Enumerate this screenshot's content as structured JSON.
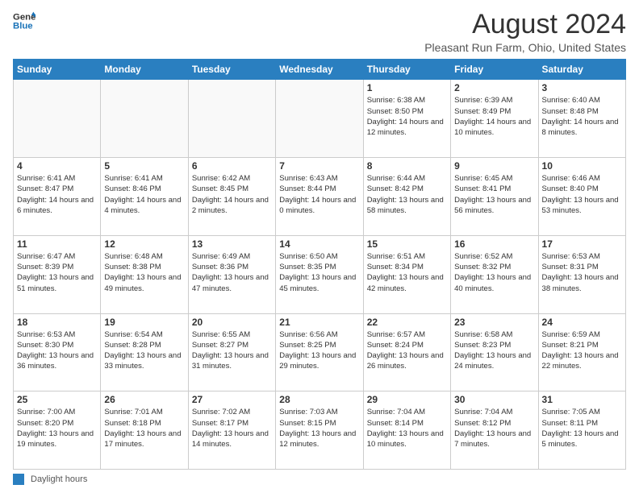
{
  "header": {
    "logo_line1": "General",
    "logo_line2": "Blue",
    "title": "August 2024",
    "subtitle": "Pleasant Run Farm, Ohio, United States"
  },
  "calendar": {
    "days_of_week": [
      "Sunday",
      "Monday",
      "Tuesday",
      "Wednesday",
      "Thursday",
      "Friday",
      "Saturday"
    ],
    "weeks": [
      [
        {
          "day": "",
          "info": ""
        },
        {
          "day": "",
          "info": ""
        },
        {
          "day": "",
          "info": ""
        },
        {
          "day": "",
          "info": ""
        },
        {
          "day": "1",
          "info": "Sunrise: 6:38 AM\nSunset: 8:50 PM\nDaylight: 14 hours and 12 minutes."
        },
        {
          "day": "2",
          "info": "Sunrise: 6:39 AM\nSunset: 8:49 PM\nDaylight: 14 hours and 10 minutes."
        },
        {
          "day": "3",
          "info": "Sunrise: 6:40 AM\nSunset: 8:48 PM\nDaylight: 14 hours and 8 minutes."
        }
      ],
      [
        {
          "day": "4",
          "info": "Sunrise: 6:41 AM\nSunset: 8:47 PM\nDaylight: 14 hours and 6 minutes."
        },
        {
          "day": "5",
          "info": "Sunrise: 6:41 AM\nSunset: 8:46 PM\nDaylight: 14 hours and 4 minutes."
        },
        {
          "day": "6",
          "info": "Sunrise: 6:42 AM\nSunset: 8:45 PM\nDaylight: 14 hours and 2 minutes."
        },
        {
          "day": "7",
          "info": "Sunrise: 6:43 AM\nSunset: 8:44 PM\nDaylight: 14 hours and 0 minutes."
        },
        {
          "day": "8",
          "info": "Sunrise: 6:44 AM\nSunset: 8:42 PM\nDaylight: 13 hours and 58 minutes."
        },
        {
          "day": "9",
          "info": "Sunrise: 6:45 AM\nSunset: 8:41 PM\nDaylight: 13 hours and 56 minutes."
        },
        {
          "day": "10",
          "info": "Sunrise: 6:46 AM\nSunset: 8:40 PM\nDaylight: 13 hours and 53 minutes."
        }
      ],
      [
        {
          "day": "11",
          "info": "Sunrise: 6:47 AM\nSunset: 8:39 PM\nDaylight: 13 hours and 51 minutes."
        },
        {
          "day": "12",
          "info": "Sunrise: 6:48 AM\nSunset: 8:38 PM\nDaylight: 13 hours and 49 minutes."
        },
        {
          "day": "13",
          "info": "Sunrise: 6:49 AM\nSunset: 8:36 PM\nDaylight: 13 hours and 47 minutes."
        },
        {
          "day": "14",
          "info": "Sunrise: 6:50 AM\nSunset: 8:35 PM\nDaylight: 13 hours and 45 minutes."
        },
        {
          "day": "15",
          "info": "Sunrise: 6:51 AM\nSunset: 8:34 PM\nDaylight: 13 hours and 42 minutes."
        },
        {
          "day": "16",
          "info": "Sunrise: 6:52 AM\nSunset: 8:32 PM\nDaylight: 13 hours and 40 minutes."
        },
        {
          "day": "17",
          "info": "Sunrise: 6:53 AM\nSunset: 8:31 PM\nDaylight: 13 hours and 38 minutes."
        }
      ],
      [
        {
          "day": "18",
          "info": "Sunrise: 6:53 AM\nSunset: 8:30 PM\nDaylight: 13 hours and 36 minutes."
        },
        {
          "day": "19",
          "info": "Sunrise: 6:54 AM\nSunset: 8:28 PM\nDaylight: 13 hours and 33 minutes."
        },
        {
          "day": "20",
          "info": "Sunrise: 6:55 AM\nSunset: 8:27 PM\nDaylight: 13 hours and 31 minutes."
        },
        {
          "day": "21",
          "info": "Sunrise: 6:56 AM\nSunset: 8:25 PM\nDaylight: 13 hours and 29 minutes."
        },
        {
          "day": "22",
          "info": "Sunrise: 6:57 AM\nSunset: 8:24 PM\nDaylight: 13 hours and 26 minutes."
        },
        {
          "day": "23",
          "info": "Sunrise: 6:58 AM\nSunset: 8:23 PM\nDaylight: 13 hours and 24 minutes."
        },
        {
          "day": "24",
          "info": "Sunrise: 6:59 AM\nSunset: 8:21 PM\nDaylight: 13 hours and 22 minutes."
        }
      ],
      [
        {
          "day": "25",
          "info": "Sunrise: 7:00 AM\nSunset: 8:20 PM\nDaylight: 13 hours and 19 minutes."
        },
        {
          "day": "26",
          "info": "Sunrise: 7:01 AM\nSunset: 8:18 PM\nDaylight: 13 hours and 17 minutes."
        },
        {
          "day": "27",
          "info": "Sunrise: 7:02 AM\nSunset: 8:17 PM\nDaylight: 13 hours and 14 minutes."
        },
        {
          "day": "28",
          "info": "Sunrise: 7:03 AM\nSunset: 8:15 PM\nDaylight: 13 hours and 12 minutes."
        },
        {
          "day": "29",
          "info": "Sunrise: 7:04 AM\nSunset: 8:14 PM\nDaylight: 13 hours and 10 minutes."
        },
        {
          "day": "30",
          "info": "Sunrise: 7:04 AM\nSunset: 8:12 PM\nDaylight: 13 hours and 7 minutes."
        },
        {
          "day": "31",
          "info": "Sunrise: 7:05 AM\nSunset: 8:11 PM\nDaylight: 13 hours and 5 minutes."
        }
      ]
    ]
  },
  "legend": {
    "label": "Daylight hours"
  }
}
